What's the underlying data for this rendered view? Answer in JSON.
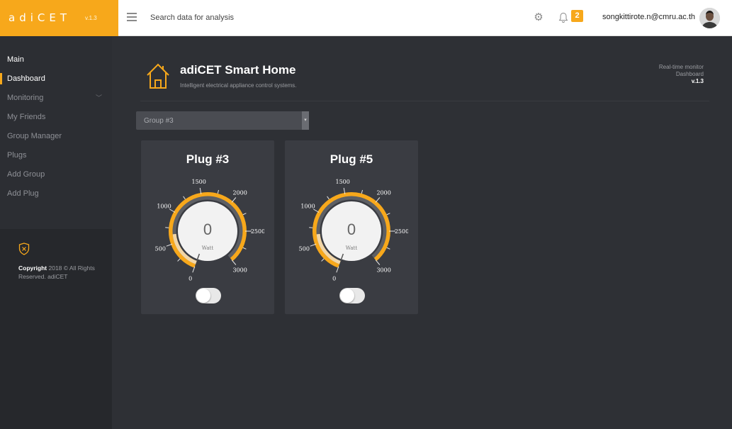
{
  "brand": {
    "name": "adiCET",
    "version": "v.1.3"
  },
  "topbar": {
    "search_placeholder": "Search data for analysis",
    "notification_count": "2",
    "user_email": "songkittirote.n@cmru.ac.th"
  },
  "sidebar": {
    "section": "Main",
    "items": [
      {
        "label": "Dashboard",
        "active": true
      },
      {
        "label": "Monitoring",
        "has_children": true
      },
      {
        "label": "My Friends"
      },
      {
        "label": "Group Manager"
      },
      {
        "label": "Plugs"
      },
      {
        "label": "Add Group"
      },
      {
        "label": "Add Plug"
      }
    ],
    "copyright_bold": "Copyright",
    "copyright_rest": " 2018 © All Rights Reserved. adiCET"
  },
  "header": {
    "title": "adiCET Smart Home",
    "subtitle": "Intelligent electrical appliance control systems.",
    "rt_line1": "Real-time monitor",
    "rt_line2": "Dashboard",
    "rt_version": "v.1.3"
  },
  "group_select": {
    "selected": "Group #3"
  },
  "plugs": [
    {
      "title": "Plug #3",
      "value": "0",
      "unit": "Watt",
      "on": false
    },
    {
      "title": "Plug #5",
      "value": "0",
      "unit": "Watt",
      "on": false
    }
  ],
  "gauge": {
    "min": 0,
    "max": 3000,
    "tick_labels": [
      "0",
      "500",
      "1000",
      "1500",
      "2000",
      "2500",
      "3000"
    ]
  },
  "colors": {
    "accent": "#f7a81b",
    "sidebar": "#2c2e33",
    "main_bg": "#2e3035",
    "card": "#3a3c42"
  }
}
